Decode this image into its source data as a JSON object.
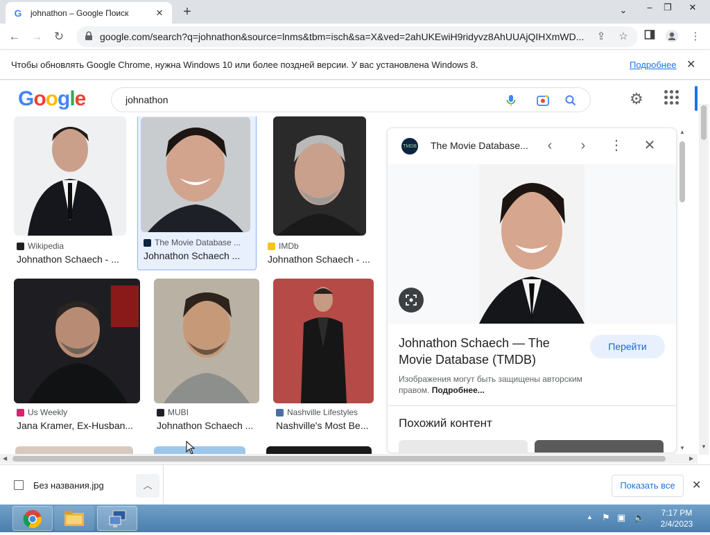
{
  "browser": {
    "tab_title": "johnathon – Google Поиск",
    "tab_favicon": "G",
    "new_tab": "+",
    "url": "google.com/search?q=johnathon&source=lnms&tbm=isch&sa=X&ved=2ahUKEwiH9ridyvz8AhUUAjQIHXmWD...",
    "window_controls": {
      "minimize": "–",
      "restore": "❐",
      "close": "✕",
      "tab_search": "⌄"
    }
  },
  "infobar": {
    "message": "Чтобы обновлять Google Chrome, нужна Windows 10 или более поздней версии. У вас установлена Windows 8.",
    "link": "Подробнее",
    "close": "✕"
  },
  "google": {
    "logo_letters": [
      "G",
      "o",
      "o",
      "g",
      "l",
      "e"
    ],
    "logo_colors": [
      "#4285f4",
      "#ea4335",
      "#fbbc05",
      "#4285f4",
      "#34a853",
      "#ea4335"
    ],
    "query": "johnathon"
  },
  "results": [
    {
      "source": "Wikipedia",
      "caption": "Johnathon Schaech - ...",
      "src_color": "#202124"
    },
    {
      "source": "The Movie Database ...",
      "caption": "Johnathon Schaech ...",
      "src_color": "#0d253f"
    },
    {
      "source": "IMDb",
      "caption": "Johnathon Schaech - ...",
      "src_color": "#f5c518"
    },
    {
      "source": "Us Weekly",
      "caption": "Jana Kramer, Ex-Husban...",
      "src_color": "#d6246e"
    },
    {
      "source": "MUBI",
      "caption": "Johnathon Schaech ...",
      "src_color": "#202124"
    },
    {
      "source": "Nashville Lifestyles",
      "caption": "Nashville's Most Be...",
      "src_color": "#4a6fa5"
    }
  ],
  "panel": {
    "favicon_text": "TMDB",
    "title": "The Movie Database...",
    "heading": "Johnathon Schaech — The Movie Database (TMDB)",
    "go_button": "Перейти",
    "note": "Изображения могут быть защищены авторским правом.",
    "note_link": "Подробнее...",
    "similar": "Похожий контент"
  },
  "download": {
    "filename": "Без названия.jpg",
    "show_all": "Показать все"
  },
  "taskbar": {
    "time": "7:17 PM",
    "date": "2/4/2023"
  },
  "colors": {
    "accent": "#1a73e8",
    "taskbar": "#4a7ead"
  }
}
